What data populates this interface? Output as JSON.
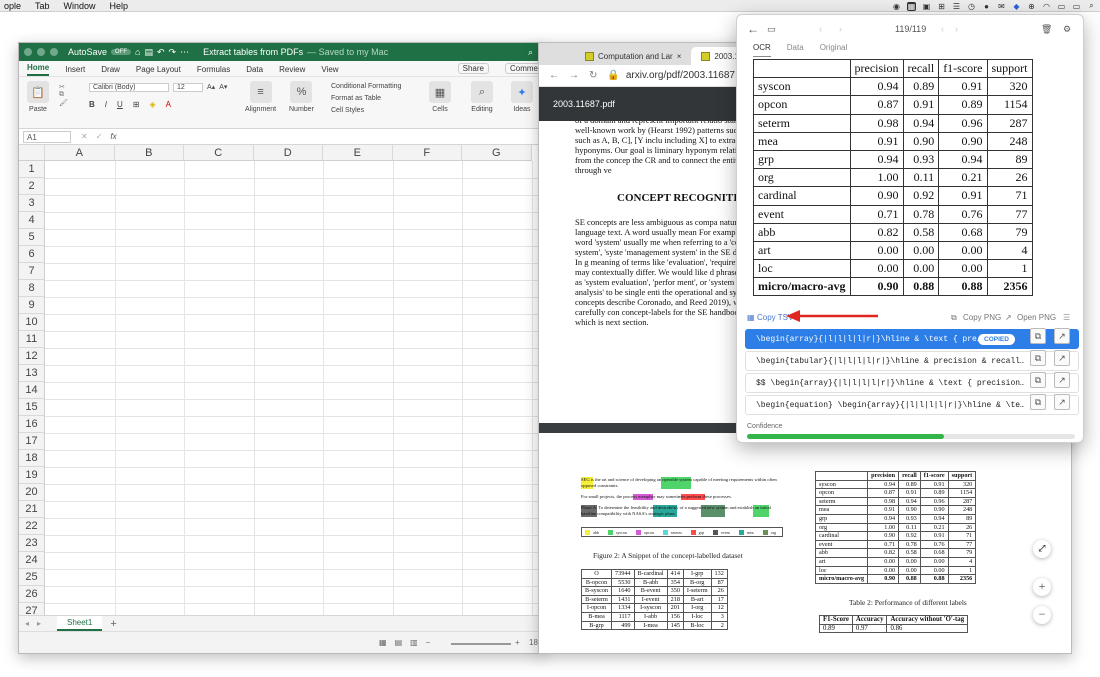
{
  "menubar": {
    "items": [
      "ople",
      "Tab",
      "Window",
      "Help"
    ]
  },
  "excel": {
    "autosave": "AutoSave",
    "autosave_state": "OFF",
    "title": "Extract tables from PDFs",
    "saved": "— Saved to my Mac",
    "tabs": [
      "Home",
      "Insert",
      "Draw",
      "Page Layout",
      "Formulas",
      "Data",
      "Review",
      "View"
    ],
    "share": "Share",
    "comments": "Comme",
    "font_name": "Calibri (Body)",
    "font_size": "12",
    "paste": "Paste",
    "alignment": "Alignment",
    "number": "Number",
    "conditional_formatting": "Conditional Formatting",
    "format_as_table": "Format as Table",
    "cell_styles": "Cell Styles",
    "cells": "Cells",
    "editing": "Editing",
    "ideas": "Ideas",
    "cell_ref": "A1",
    "fx": "fx",
    "columns": [
      "A",
      "B",
      "C",
      "D",
      "E",
      "F",
      "G"
    ],
    "rows": [
      "1",
      "2",
      "3",
      "4",
      "5",
      "6",
      "7",
      "8",
      "9",
      "10",
      "11",
      "12",
      "13",
      "14",
      "15",
      "16",
      "17",
      "18",
      "19",
      "20",
      "21",
      "22",
      "23",
      "24",
      "25",
      "26",
      "27"
    ],
    "sheet_tab": "Sheet1",
    "zoom": "18"
  },
  "browser": {
    "tabs": [
      {
        "label": "Computation and Lar"
      },
      {
        "label": "2003.1"
      }
    ],
    "url": "arxiv.org/pdf/2003.11687.pdf",
    "pdf_name": "2003.11687.pdf",
    "page1": {
      "para1": "of a domain and represent important relatio stance, a well-known work by (Hearst 1992) patterns such as [Y such as A, B, C], [Y inclu including X] to extract hyponyms. Our goal is liminary hyponym relations from the concep the CR and to connect the entities through ve",
      "heading": "CONCEPT RECOGNITIO",
      "para2": "SE concepts are less ambiguous as compa natural language text. A word usually mean For example, the word 'system' usually me when referring to a 'complex system', 'syste 'management system' in the SE domain. In g meaning of terms like 'evaluation', 'requiren ysis' may contextually differ. We would like d phrases such as 'system evaluation', 'perfor ment', or 'system analysis' to be single enti the operational and system concepts describe Coronado, and Reed 2019), we carefully con concept-labels for the SE handbook which is next section."
    },
    "page2": {
      "snippet_lines": [
        "SEG is the art and science of developing an operable system capable of meeting requirements within often opposed constraints.",
        "For small projects, the process metaphor may sometimes perform these processes.",
        "Phase A: To determine the feasibility and desirability of a suggested new system and establish an initial baseline compatibility with NASA's strategic plans."
      ],
      "legend": [
        "abb",
        "syscon",
        "opcon",
        "seterm",
        "grp",
        "event",
        "mea",
        "org"
      ],
      "fig_caption": "Figure 2: A Snippet of the concept-labelled dataset",
      "table2_caption": "Table 2: Performance of different labels",
      "tag_table": [
        [
          "O",
          "73944",
          "B-cardinal",
          "414",
          "I-grp",
          "132"
        ],
        [
          "B-opcon",
          "5530",
          "B-abb",
          "354",
          "B-org",
          "87"
        ],
        [
          "B-syscon",
          "1640",
          "B-event",
          "350",
          "I-seterm",
          "26"
        ],
        [
          "B-seterm",
          "1431",
          "I-event",
          "218",
          "B-art",
          "17"
        ],
        [
          "I-opcon",
          "1334",
          "I-syscon",
          "201",
          "I-org",
          "12"
        ],
        [
          "B-mea",
          "1117",
          "I-abb",
          "156",
          "I-loc",
          "3"
        ],
        [
          "B-grp",
          "499",
          "I-mea",
          "145",
          "B-loc",
          "2"
        ]
      ],
      "f1_table": {
        "headers": [
          "F1-Score",
          "Accuracy",
          "Accuracy without 'O'-tag"
        ],
        "row": [
          "0.89",
          "0.97",
          "0.86"
        ]
      }
    }
  },
  "ocr": {
    "counter": "119/119",
    "modes": [
      "OCR",
      "Data",
      "Original"
    ],
    "table_headers": [
      "",
      "precision",
      "recall",
      "f1-score",
      "support"
    ],
    "table_rows": [
      [
        "syscon",
        "0.94",
        "0.89",
        "0.91",
        "320"
      ],
      [
        "opcon",
        "0.87",
        "0.91",
        "0.89",
        "1154"
      ],
      [
        "seterm",
        "0.98",
        "0.94",
        "0.96",
        "287"
      ],
      [
        "mea",
        "0.91",
        "0.90",
        "0.90",
        "248"
      ],
      [
        "grp",
        "0.94",
        "0.93",
        "0.94",
        "89"
      ],
      [
        "org",
        "1.00",
        "0.11",
        "0.21",
        "26"
      ],
      [
        "cardinal",
        "0.90",
        "0.92",
        "0.91",
        "71"
      ],
      [
        "event",
        "0.71",
        "0.78",
        "0.76",
        "77"
      ],
      [
        "abb",
        "0.82",
        "0.58",
        "0.68",
        "79"
      ],
      [
        "art",
        "0.00",
        "0.00",
        "0.00",
        "4"
      ],
      [
        "loc",
        "0.00",
        "0.00",
        "0.00",
        "1"
      ]
    ],
    "table_total": [
      "micro/macro-avg",
      "0.90",
      "0.88",
      "0.88",
      "2356"
    ],
    "copy_tsv": "Copy TSV",
    "copy_png": "Copy PNG",
    "open_png": "Open PNG",
    "options": [
      "\\begin{array}{|l|l|l|l|r|}\\hline & \\text { pre…",
      "\\begin{tabular}{|l|l|l|l|r|}\\hline & precision & recall…",
      "$$ \\begin{array}{|l|l|l|l|r|}\\hline & \\text { precision…",
      "\\begin{equation} \\begin{array}{|l|l|l|l|r|}\\hline & \\te…"
    ],
    "copied_badge": "COPIED",
    "confidence_label": "Confidence",
    "confidence": 0.6
  },
  "colors": {
    "excel_green": "#1f7145",
    "accent_blue": "#2d7ee6",
    "confidence_green": "#33b549",
    "arrow_red": "#e0271f"
  }
}
